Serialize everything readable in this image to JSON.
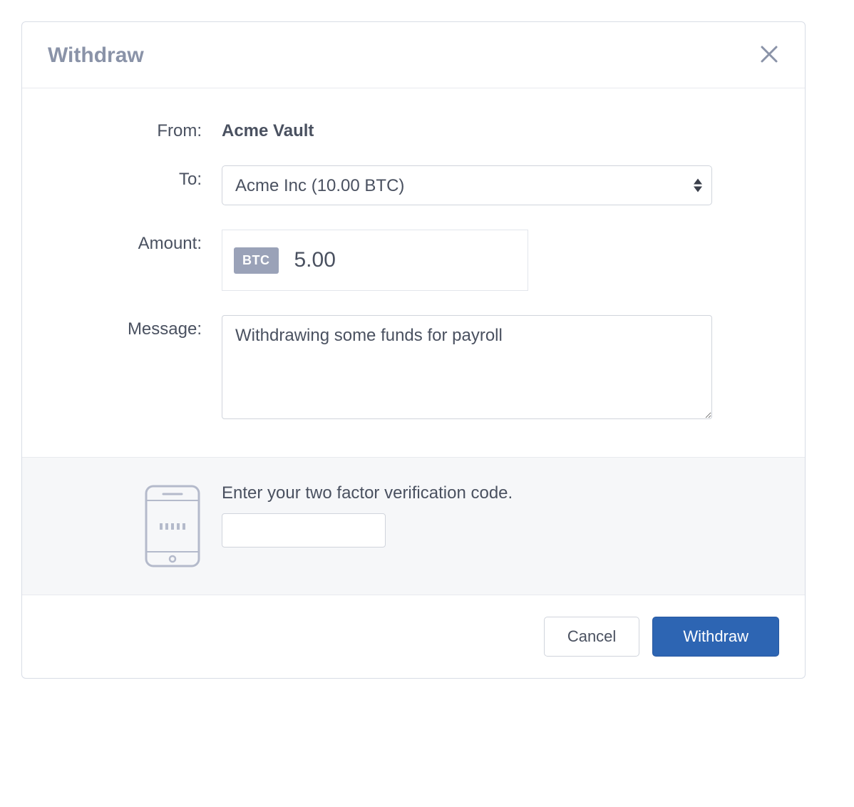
{
  "modal": {
    "title": "Withdraw"
  },
  "form": {
    "from_label": "From:",
    "from_value": "Acme Vault",
    "to_label": "To:",
    "to_selected": "Acme Inc (10.00 BTC)",
    "amount_label": "Amount:",
    "amount_currency": "BTC",
    "amount_value": "5.00",
    "message_label": "Message:",
    "message_value": "Withdrawing some funds for payroll"
  },
  "twofa": {
    "prompt": "Enter your two factor verification code.",
    "code_value": ""
  },
  "footer": {
    "cancel_label": "Cancel",
    "submit_label": "Withdraw"
  }
}
